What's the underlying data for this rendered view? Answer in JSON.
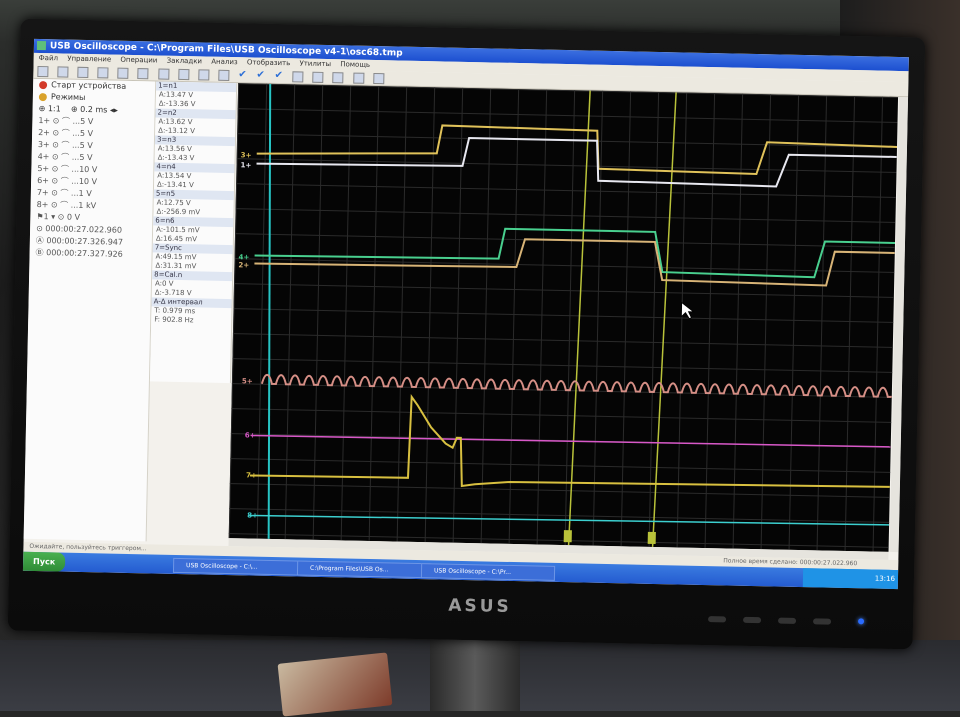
{
  "window": {
    "title": "USB Oscilloscope - C:\\Program Files\\USB Oscilloscope v4-1\\osc68.tmp"
  },
  "menu": [
    "Файл",
    "Управление",
    "Операции",
    "Закладки",
    "Анализ",
    "Отобразить",
    "Утилиты",
    "Помощь"
  ],
  "left_panel": {
    "start_label": "Старт устройства",
    "modes_label": "Режимы",
    "ratio": "1:1",
    "timebase": "0.2 ms",
    "channels": [
      {
        "label": "1+ ⊙ ⌒  ...5 V"
      },
      {
        "label": "2+ ⊙ ⌒  ...5 V"
      },
      {
        "label": "3+ ⊙ ⌒  ...5 V"
      },
      {
        "label": "4+ ⊙ ⌒  ...5 V"
      },
      {
        "label": "5+ ⊙ ⌒  ...10 V"
      },
      {
        "label": "6+ ⊙ ⌒  ...10 V"
      },
      {
        "label": "7+ ⊙ ⌒  ...1 V"
      },
      {
        "label": "8+ ⊙ ⌒  ...1 kV"
      }
    ],
    "trigger_level": "0 V",
    "time_total": "000:00:27.022.960",
    "time_a": "000:00:27.326.947",
    "time_b": "000:00:27.327.926"
  },
  "measurements": [
    {
      "head": "1=n1",
      "a": "A:13.47 V",
      "d": "Δ:-13.36 V"
    },
    {
      "head": "2=n2",
      "a": "A:13.62 V",
      "d": "Δ:-13.12 V"
    },
    {
      "head": "3=n3",
      "a": "A:13.56 V",
      "d": "Δ:-13.43 V"
    },
    {
      "head": "4=n4",
      "a": "A:13.54 V",
      "d": "Δ:-13.41 V"
    },
    {
      "head": "5=n5",
      "a": "A:12.75 V",
      "d": "Δ:-256.9 mV"
    },
    {
      "head": "6=n6",
      "a": "A:-101.5 mV",
      "d": "Δ:16.45 mV"
    },
    {
      "head": "7=Sync",
      "a": "A:49.15 mV",
      "d": "Δ:31.31 mV"
    },
    {
      "head": "8=Cal.n",
      "a": "A:0 V",
      "d": "Δ:-3.718 V"
    }
  ],
  "interval": {
    "label": "A-Δ интервал",
    "t": "T: 0.979 ms",
    "f": "F: 902.8 Hz"
  },
  "channel_markers": [
    "3+",
    "1+",
    "4+",
    "2+",
    "5+",
    "6+",
    "7+",
    "8+"
  ],
  "colors": {
    "ch1": "#e8e8f0",
    "ch2": "#d8b477",
    "ch3": "#e0c25a",
    "ch4": "#49d08f",
    "ch5": "#d68f86",
    "ch6": "#d858c8",
    "ch7": "#d8c040",
    "ch8": "#3ccfcf",
    "cursor": "#b9c23a",
    "trigger": "#27c4c4"
  },
  "statusbar": {
    "left": "Ожидайте, пользуйтесь триггером...",
    "right": "Полное время сделано: 000:00:27.022.960"
  },
  "taskbar": {
    "start": "Пуск",
    "tasks": [
      "USB Oscilloscope - C:\\...",
      "C:\\Program Files\\USB Os...",
      "USB Oscilloscope - C:\\Pr..."
    ],
    "clock": "13:16"
  },
  "monitor_brand": "ASUS"
}
